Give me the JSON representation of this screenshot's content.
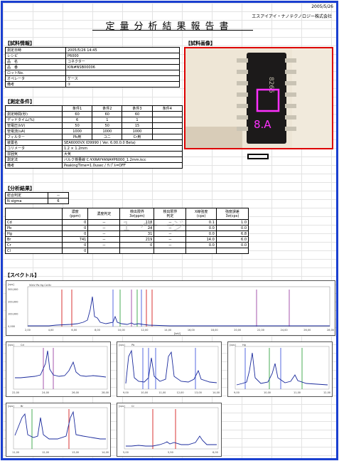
{
  "header": {
    "date": "2005/5/26",
    "title": "定量分析結果報告書",
    "company": "エスアイアイ・ナノテクノロジー株式会社"
  },
  "sections": {
    "sample_info": "【試料情報】",
    "sample_image": "【試料画像】",
    "measure_cond": "【測定条件】",
    "analysis": "【分析結果】",
    "spectrum": "【スペクトル】"
  },
  "sample_info": {
    "rows": [
      {
        "label": "測定日時",
        "value": "2005/5/26 14:45"
      },
      {
        "label": "レシピ",
        "value": "P6000"
      },
      {
        "label": "品　名",
        "value": "コネクター"
      },
      {
        "label": "品　番",
        "value": "KIN#NSB00006"
      },
      {
        "label": "ロットNo.",
        "value": ""
      },
      {
        "label": "オペレータ",
        "value": "ケース"
      },
      {
        "label": "備考",
        "value": "①"
      }
    ]
  },
  "image": {
    "chip_text": "8.A",
    "chip_marking": "8265"
  },
  "conditions": {
    "headers": [
      "",
      "条件1",
      "条件2",
      "条件3",
      "条件4"
    ],
    "rows": [
      [
        "測定時間(秒)",
        "60",
        "60",
        "60",
        ""
      ],
      [
        "デッドタイム(%)",
        "6",
        "1",
        "1",
        ""
      ],
      [
        "管電圧(kV)",
        "50",
        "50",
        "15",
        ""
      ],
      [
        "管電流(uA)",
        "1000",
        "1000",
        "1000",
        ""
      ],
      [
        "フィルター",
        "Pb用",
        "ユニ",
        "Cr用",
        ""
      ]
    ],
    "extra": [
      {
        "label": "装置名",
        "value": "SEA6000VX ID9990 ( Ver. 6.00.0.0 Beta)"
      },
      {
        "label": "コリメータ",
        "value": "1.2 × 1.2mm"
      },
      {
        "label": "雰囲気",
        "value": "大気"
      },
      {
        "label": "測定法",
        "value": "バルク検量線 C:¥XRAY¥ANA¥P6000_1.2mm.kcc"
      },
      {
        "label": "備考",
        "value": "PeakingTime=1.0usec / ｻﾝﾌﾟﾙ=OFF"
      }
    ]
  },
  "analysis": {
    "judge_label": "総合判定",
    "judge_value": "－",
    "sigma_label": "N sigma",
    "sigma_value": "6",
    "headers": [
      "",
      "濃度\n(ppm)",
      "濃度判定",
      "検出限界\n3σ(ppm)",
      "検出限界\n判定",
      "X線強度\n(cps)",
      "強度誤差\n3σ(cps)"
    ],
    "rows": [
      [
        "Cd",
        "0",
        "－",
        "118",
        "－",
        "0.1",
        "1.0"
      ],
      [
        "Pb",
        "0",
        "－",
        "24",
        "－",
        "0.0",
        "0.0"
      ],
      [
        "Hg",
        "0",
        "－",
        "31",
        "－",
        "0.0",
        "6.8"
      ],
      [
        "Br",
        "741",
        "－",
        "219",
        "－",
        "14.0",
        "6.0"
      ],
      [
        "Cr",
        "0",
        "－",
        "0",
        "－",
        "0.0",
        "0.0"
      ],
      [
        "Cl",
        "0",
        "",
        "",
        "",
        "",
        ""
      ]
    ],
    "watermark": "1 ページ"
  },
  "spectra": {
    "main": {
      "ylabel": "[cps]",
      "title": "50kV Pb Hg Cd Br",
      "xlabel": "[keV]",
      "yticks": [
        "300,000",
        "200,000",
        "100,000",
        "0,000"
      ],
      "xticks": [
        "2,00",
        "4,00",
        "6,00",
        "8,00",
        "10,00",
        "12,00",
        "14,00",
        "16,00",
        "18,00",
        "20,00",
        "22,00",
        "24,00",
        "26,00",
        "28,00"
      ]
    },
    "small": [
      {
        "label": "Cd",
        "xticks": [
          "22,00",
          "24,00",
          "26,00",
          "28,00"
        ]
      },
      {
        "label": "Pb",
        "xticks": [
          "9,00",
          "10,00",
          "11,00",
          "12,00",
          "13,00",
          "14,00"
        ]
      },
      {
        "label": "Hg",
        "xticks": [
          "9,00",
          "10,00",
          "11,00",
          "12,00"
        ]
      },
      {
        "label": "Br",
        "xticks": [
          "11,00",
          "12,00",
          "13,00",
          "14,00"
        ]
      },
      {
        "label": "Cr",
        "xticks": [
          "5,00",
          "5,50",
          "6,00"
        ]
      }
    ]
  },
  "colors": {
    "frame": "#1a3fd0",
    "photo_border": "#d00000",
    "spectrum": "#1a2a9c",
    "marker_red": "#d00000",
    "marker_purple": "#8e2a9a",
    "marker_green": "#1b9a2c",
    "marker_blue": "#2a45d8"
  }
}
